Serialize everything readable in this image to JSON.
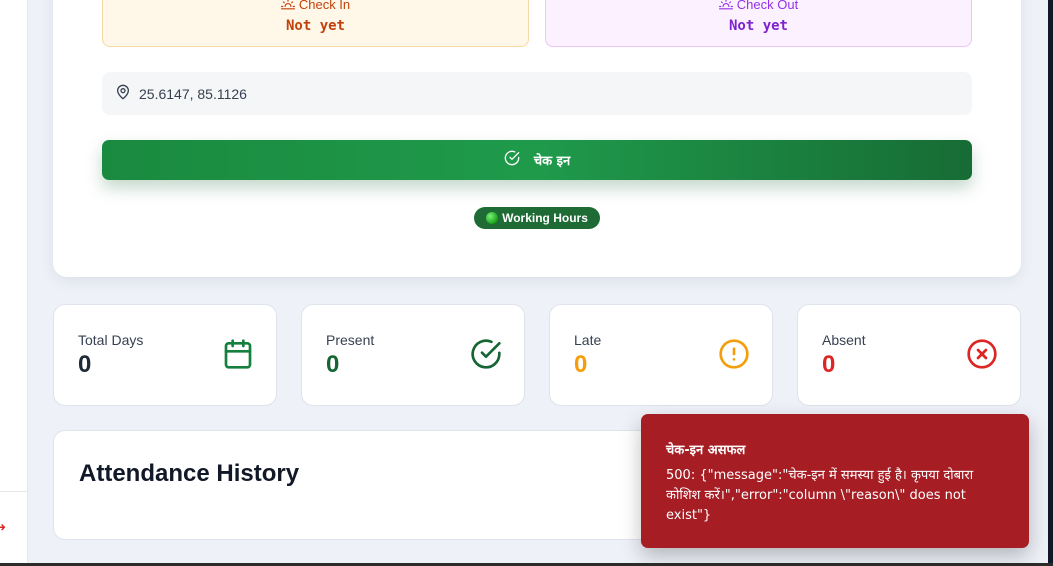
{
  "checkin_box": {
    "label": "Check In",
    "value": "Not yet",
    "icon": "sunrise-icon"
  },
  "checkout_box": {
    "label": "Check Out",
    "value": "Not yet",
    "icon": "sunset-icon"
  },
  "location": {
    "coords": "25.6147, 85.1126",
    "icon": "map-pin-icon"
  },
  "checkin_button": {
    "label": "चेक इन",
    "icon": "check-circle-icon"
  },
  "working_hours": {
    "label": "Working Hours"
  },
  "stats": [
    {
      "label": "Total Days",
      "value": "0",
      "color": "#1f2937",
      "icon": "calendar-icon",
      "icon_color": "#15803d"
    },
    {
      "label": "Present",
      "value": "0",
      "color": "#166534",
      "icon": "check-circle-icon",
      "icon_color": "#166534"
    },
    {
      "label": "Late",
      "value": "0",
      "color": "#f59e0b",
      "icon": "alert-circle-icon",
      "icon_color": "#f59e0b"
    },
    {
      "label": "Absent",
      "value": "0",
      "color": "#dc2626",
      "icon": "x-circle-icon",
      "icon_color": "#dc2626"
    }
  ],
  "history": {
    "title": "Attendance History"
  },
  "toast": {
    "title": "चेक-इन असफल",
    "message": "500: {\"message\":\"चेक-इन में समस्या हुई है। कृपया दोबारा कोशिश करें।\",\"error\":\"column \\\"reason\\\" does not exist\"}"
  }
}
